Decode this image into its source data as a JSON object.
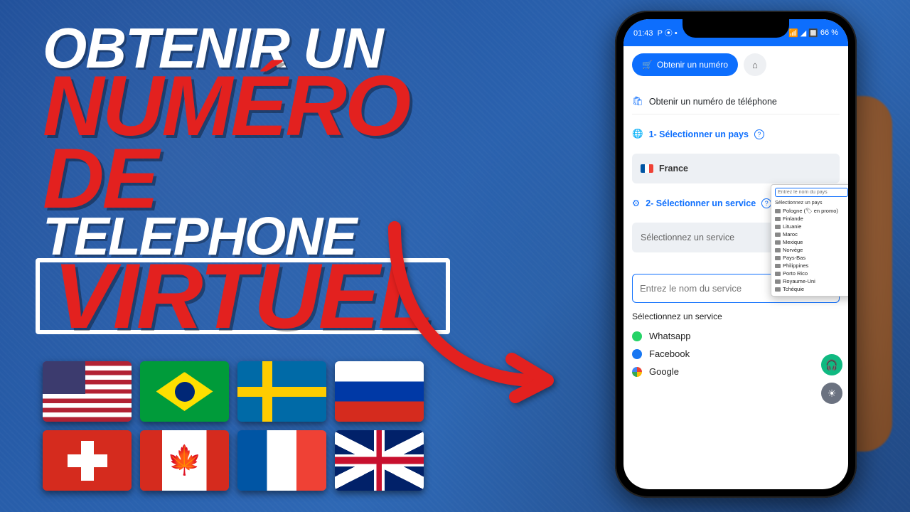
{
  "headline": {
    "l1": "OBTENIR UN",
    "l2": "NUMÉRO DE",
    "l3": "TELEPHONE",
    "l4": "VIRTUEL"
  },
  "flags": [
    "us",
    "br",
    "se",
    "ru",
    "ch",
    "ca",
    "fr",
    "gb"
  ],
  "status": {
    "time": "01:43",
    "extras": "P  ⦿ •",
    "battery": "66 %"
  },
  "app": {
    "btn_obtain": "Obtenir un numéro",
    "title": "Obtenir un numéro de téléphone",
    "step1": "1- Sélectionner un pays",
    "country": "France",
    "step2": "2- Sélectionner un service",
    "service_placeholder": "Sélectionnez un service",
    "search_placeholder": "Entrez le nom du service",
    "service_list_title": "Sélectionnez un service",
    "services": [
      {
        "icon": "wa",
        "label": "Whatsapp"
      },
      {
        "icon": "fb",
        "label": "Facebook"
      },
      {
        "icon": "go",
        "label": "Google"
      }
    ]
  },
  "dropdown": {
    "search": "Entrez le nom du pays",
    "title": "Sélectionnez un pays",
    "items": [
      "Pologne (🏷 en promo)",
      "Finlande",
      "Lituanie",
      "Maroc",
      "Mexique",
      "Norvège",
      "Pays-Bas",
      "Philippines",
      "Porto Rico",
      "Royaume-Uni",
      "Tchéquie"
    ]
  }
}
